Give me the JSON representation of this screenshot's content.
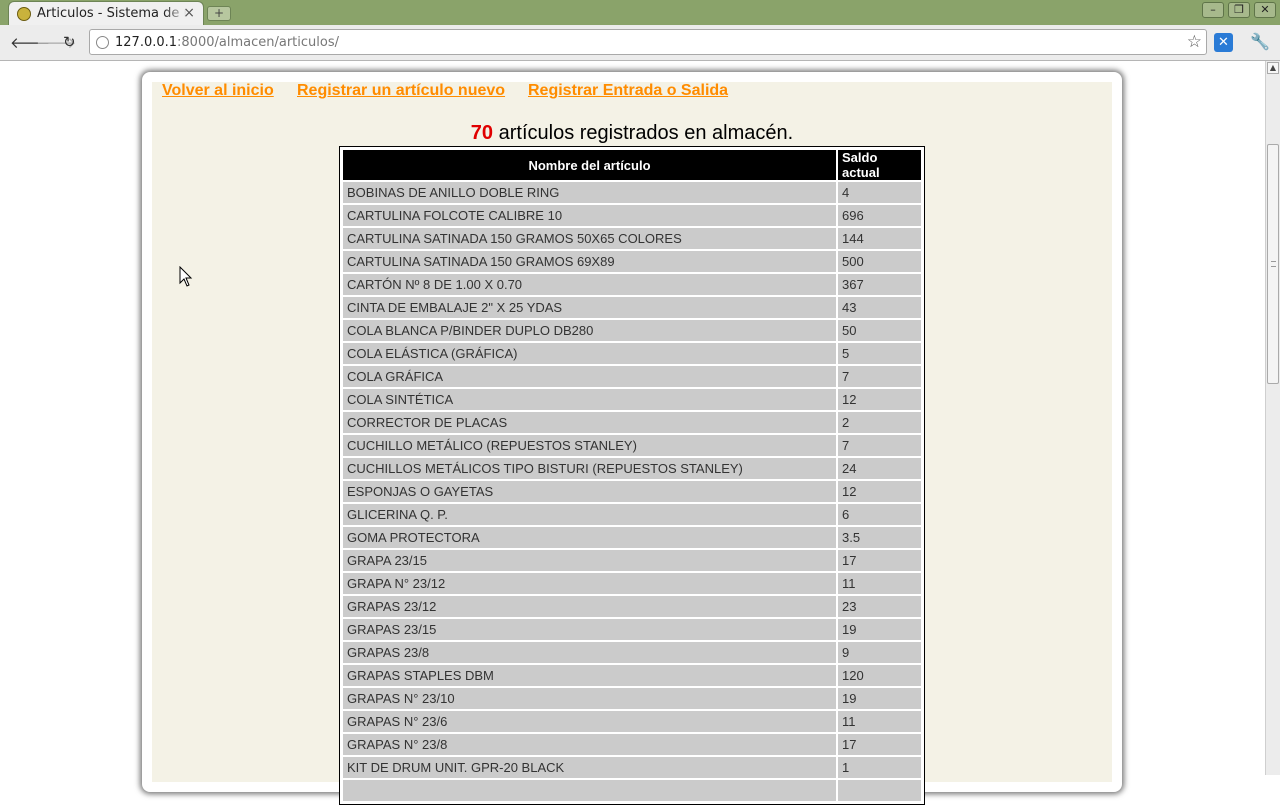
{
  "browser": {
    "tab_title": "Articulos - Sistema de re",
    "tab_close": "×",
    "new_tab": "+",
    "url_host": "127.0.0.1",
    "url_path": ":8000/almacen/articulos/"
  },
  "nav": {
    "home": "Volver al inicio",
    "new_article": "Registrar un artículo nuevo",
    "entry_exit": "Registrar Entrada o Salida"
  },
  "heading": {
    "count": "70",
    "text": " artículos registrados en almacén."
  },
  "table": {
    "headers": [
      "Nombre del artículo",
      "Saldo actual"
    ],
    "rows": [
      [
        "BOBINAS DE ANILLO DOBLE RING",
        "4"
      ],
      [
        "CARTULINA FOLCOTE CALIBRE 10",
        "696"
      ],
      [
        "CARTULINA SATINADA 150 GRAMOS 50X65 COLORES",
        "144"
      ],
      [
        "CARTULINA SATINADA 150 GRAMOS 69X89",
        "500"
      ],
      [
        "CARTÓN Nº 8 DE 1.00 X 0.70",
        "367"
      ],
      [
        "CINTA DE EMBALAJE 2\" X 25 YDAS",
        "43"
      ],
      [
        "COLA BLANCA P/BINDER DUPLO DB280",
        "50"
      ],
      [
        "COLA ELÁSTICA (GRÁFICA)",
        "5"
      ],
      [
        "COLA GRÁFICA",
        "7"
      ],
      [
        "COLA SINTÉTICA",
        "12"
      ],
      [
        "CORRECTOR DE PLACAS",
        "2"
      ],
      [
        "CUCHILLO METÁLICO (REPUESTOS STANLEY)",
        "7"
      ],
      [
        "CUCHILLOS METÁLICOS TIPO BISTURI (REPUESTOS STANLEY)",
        "24"
      ],
      [
        "ESPONJAS O GAYETAS",
        "12"
      ],
      [
        "GLICERINA Q. P.",
        "6"
      ],
      [
        "GOMA PROTECTORA",
        "3.5"
      ],
      [
        "GRAPA 23/15",
        "17"
      ],
      [
        "GRAPA N° 23/12",
        "11"
      ],
      [
        "GRAPAS 23/12",
        "23"
      ],
      [
        "GRAPAS 23/15",
        "19"
      ],
      [
        "GRAPAS 23/8",
        "9"
      ],
      [
        "GRAPAS STAPLES DBM",
        "120"
      ],
      [
        "GRAPAS N° 23/10",
        "19"
      ],
      [
        "GRAPAS N° 23/6",
        "11"
      ],
      [
        "GRAPAS N° 23/8",
        "17"
      ],
      [
        "KIT DE DRUM UNIT. GPR-20 BLACK",
        "1"
      ],
      [
        "",
        ""
      ]
    ]
  },
  "icons": {
    "back": "back-arrow-icon",
    "forward": "forward-arrow-icon",
    "reload": "reload-icon",
    "bookmark": "star-icon",
    "extension": "extension-icon",
    "menu": "wrench-icon"
  },
  "colors": {
    "link": "#ff8c00",
    "count": "#e00000",
    "table_header_bg": "#000000",
    "row_bg": "#cbcbcb",
    "page_bg": "#f4f2e6",
    "titlebar": "#8aa36a"
  }
}
